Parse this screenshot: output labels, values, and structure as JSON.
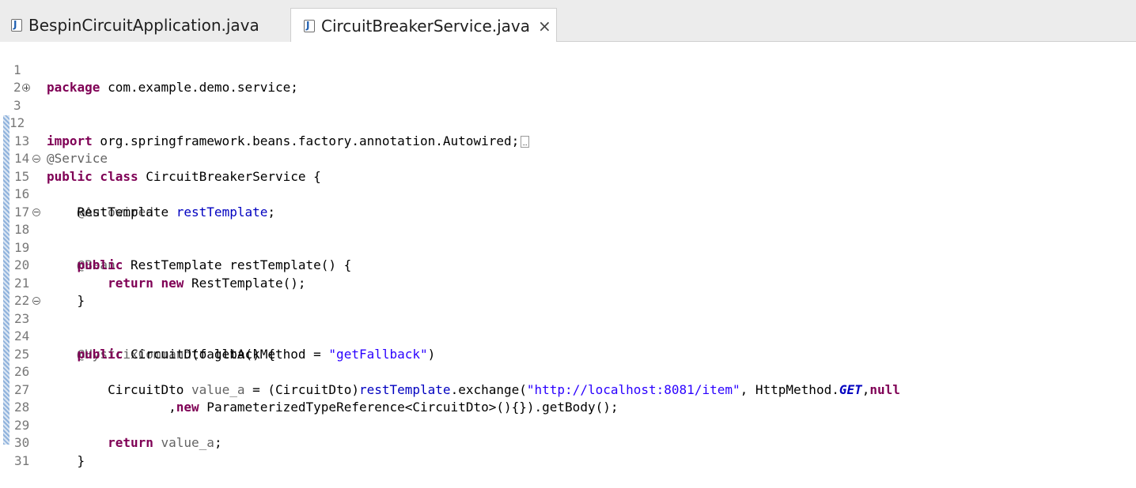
{
  "tabs": [
    {
      "label": "BespinCircuitApplication.java",
      "active": false
    },
    {
      "label": "CircuitBreakerService.java",
      "active": true
    }
  ],
  "close_glyph": "×",
  "editor": {
    "lines": [
      {
        "n": "1",
        "t": "package",
        "r": " com.example.demo.service;"
      },
      {
        "n": "2"
      },
      {
        "n": "3",
        "t": "import",
        "r": " org.springframework.beans.factory.annotation.Autowired;"
      },
      {
        "n": "12"
      },
      {
        "n": "13",
        "t": "@Service"
      },
      {
        "n": "14",
        "t": "public class",
        "r": " CircuitBreakerService {"
      },
      {
        "n": "15",
        "t": "    @Autowired"
      },
      {
        "n": "16",
        "t": "    RestTemplate ",
        "r": "restTemplate",
        "s": ";"
      },
      {
        "n": "17"
      },
      {
        "n": "18",
        "t": "    @Bean"
      },
      {
        "n": "19",
        "t": "    ",
        "r": "public",
        "s": " RestTemplate restTemplate() {"
      },
      {
        "n": "20",
        "t": "        ",
        "r": "return new",
        "s": " RestTemplate();"
      },
      {
        "n": "21",
        "t": "    }"
      },
      {
        "n": "22"
      },
      {
        "n": "23",
        "t": "    @HystrixCommand",
        "r": "(fallbackMethod = ",
        "s": "\"getFallback\"",
        "u": ")"
      },
      {
        "n": "24",
        "t": "    ",
        "r": "public",
        "s": " CircuitDto getA() {"
      },
      {
        "n": "25"
      },
      {
        "n": "26",
        "t": "        CircuitDto ",
        "r": "value_a",
        "s": " = (CircuitDto)",
        "u": "restTemplate",
        "v": ".exchange(",
        "w": "\"http://localhost:8081/item\"",
        "x": ", HttpMethod.",
        "y": "GET",
        "z": ",",
        "aa": "null"
      },
      {
        "n": "27",
        "t": "                ,",
        "r": "new",
        "s": " ParameterizedTypeReference<CircuitDto>(){}).getBody();"
      },
      {
        "n": "28"
      },
      {
        "n": "29",
        "t": "        ",
        "r": "return",
        "s": " ",
        "u": "value_a",
        "v": ";"
      },
      {
        "n": "30",
        "t": "    }"
      },
      {
        "n": "31"
      }
    ]
  }
}
